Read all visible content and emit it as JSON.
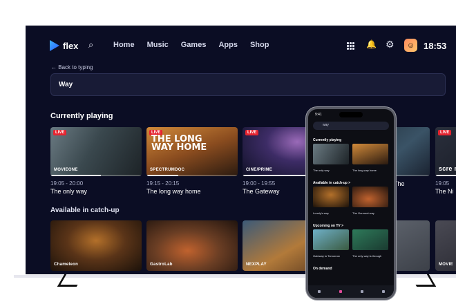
{
  "brand": {
    "name": "flex"
  },
  "nav": {
    "links": [
      "Home",
      "Music",
      "Games",
      "Apps",
      "Shop"
    ],
    "time": "18:53",
    "icons": [
      "search-icon",
      "apps-grid-icon",
      "bell-icon",
      "gear-icon"
    ]
  },
  "search": {
    "back_label": "Back to typing",
    "value": "Way"
  },
  "sections": {
    "currently_playing": "Currently playing",
    "catch_up": "Available in catch-up"
  },
  "now_playing": [
    {
      "badge": "LIVE",
      "channel": "MOVIEONE",
      "time": "19:05 - 20:00",
      "title": "The only way",
      "progress": 0.55,
      "art": "#4a5a60"
    },
    {
      "badge": "LIVE",
      "channel": "SPECTRUMDOC",
      "time": "19:15 - 20:15",
      "title": "The long way home",
      "progress": 0.35,
      "art": "#a8662a",
      "overlay": "THE LONG\nWAY HOME"
    },
    {
      "badge": "LIVE",
      "channel": "CINE/PRIME",
      "time": "19:00 - 19:55",
      "title": "The Gateway",
      "progress": 0.7,
      "art": "#403466"
    },
    {
      "badge": "",
      "channel": "",
      "time": "",
      "title": "The",
      "progress": 0.4,
      "art": "#2b3a46"
    },
    {
      "badge": "LIVE",
      "channel": "scre mo",
      "time": "19:05",
      "title": "The Ni",
      "progress": 0.5,
      "art": "#1e2330"
    }
  ],
  "catch_up": [
    {
      "channel": "Chameleon",
      "art": "#5a3418"
    },
    {
      "channel": "GastroLab",
      "art": "#6b3e24"
    },
    {
      "channel": "NEXPLAY",
      "art": "#7a5a3a"
    },
    {
      "channel": "",
      "art": "#505560"
    },
    {
      "channel": "MOVIE",
      "art": "#3a3a44"
    }
  ],
  "phone": {
    "status_time": "9:41",
    "search_value": "way",
    "sections": [
      "Currently playing",
      "Available in catch-up >",
      "Upcoming on TV >",
      "On demand"
    ],
    "row1": [
      "The only way",
      "The long way home"
    ],
    "row2": [
      "Lonely's way",
      "The Gourmet way"
    ],
    "row3": [
      "Gateway to Tomorrow",
      "The only way is through"
    ],
    "tabs": [
      "Home",
      "Channels",
      "Search",
      "Account"
    ]
  }
}
